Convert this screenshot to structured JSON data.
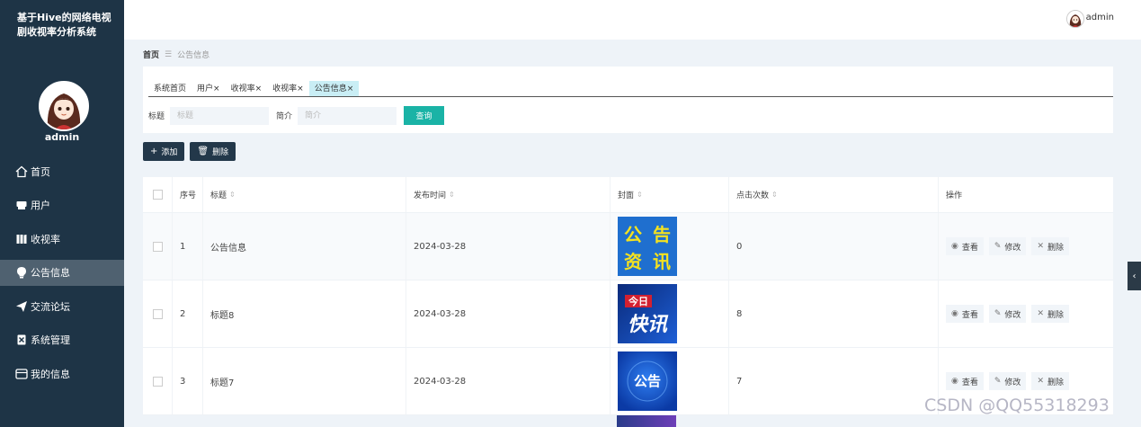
{
  "app": {
    "title": "基于Hive的网络电视剧收视率分析系统",
    "username": "admin"
  },
  "sidebar": {
    "items": [
      {
        "label": "首页",
        "icon": "home-icon"
      },
      {
        "label": "用户",
        "icon": "user-icon"
      },
      {
        "label": "收视率",
        "icon": "book-icon"
      },
      {
        "label": "公告信息",
        "icon": "bulb-icon",
        "active": true
      },
      {
        "label": "交流论坛",
        "icon": "send-icon"
      },
      {
        "label": "系统管理",
        "icon": "tool-icon"
      },
      {
        "label": "我的信息",
        "icon": "card-icon"
      }
    ]
  },
  "topbar": {
    "username": "admin"
  },
  "breadcrumb": {
    "home": "首页",
    "sep": "☰",
    "current": "公告信息"
  },
  "tabs": [
    {
      "label": "系统首页",
      "close": ""
    },
    {
      "label": "用户",
      "close": "×"
    },
    {
      "label": "收视率",
      "close": "×"
    },
    {
      "label": "收视率",
      "close": "×"
    },
    {
      "label": "公告信息",
      "close": "×",
      "active": true
    }
  ],
  "search": {
    "title_label": "标题",
    "title_placeholder": "标题",
    "intro_label": "简介",
    "intro_placeholder": "简介",
    "query_button": "查询"
  },
  "toolbar": {
    "add_label": "添加",
    "delete_label": "删除"
  },
  "table": {
    "columns": [
      "序号",
      "标题",
      "发布时间",
      "封面",
      "点击次数",
      "操作"
    ],
    "rows": [
      {
        "index": "1",
        "title": "公告信息",
        "date": "2024-03-28",
        "cover_text": [
          "公",
          "告",
          "资",
          "讯"
        ],
        "clicks": "0"
      },
      {
        "index": "2",
        "title": "标题8",
        "date": "2024-03-28",
        "cover_text": [
          "今日",
          "快讯"
        ],
        "clicks": "8"
      },
      {
        "index": "3",
        "title": "标题7",
        "date": "2024-03-28",
        "cover_text": [
          "公告"
        ],
        "clicks": "7"
      }
    ],
    "row_actions": {
      "view": "查看",
      "edit": "修改",
      "delete": "删除"
    }
  },
  "watermark": "CSDN @QQ55318293",
  "colors": {
    "sidebar": "#1e3446",
    "accent": "#1ab3a6",
    "dark_button": "#23384a",
    "active_tab": "#c9eef5"
  }
}
